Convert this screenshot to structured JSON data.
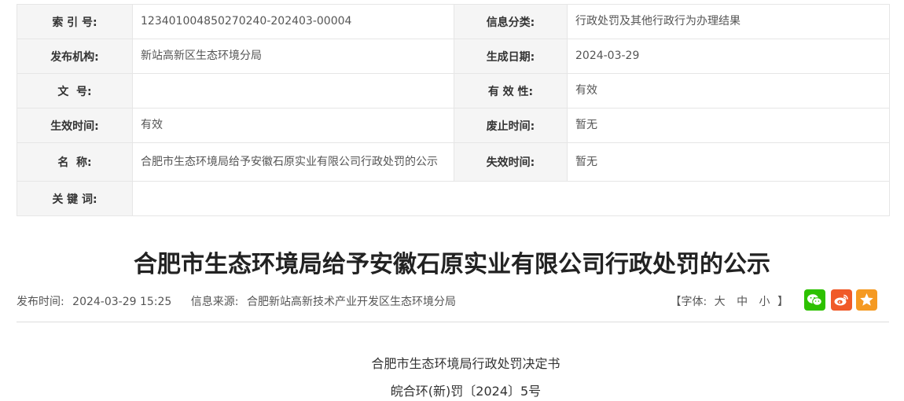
{
  "meta": {
    "rows": [
      {
        "l1": "索 引 号:",
        "v1": "123401004850270240-202403-00004",
        "l2": "信息分类:",
        "v2": "行政处罚及其他行政行为办理结果"
      },
      {
        "l1": "发布机构:",
        "v1": "新站高新区生态环境分局",
        "l2": "生成日期:",
        "v2": "2024-03-29"
      },
      {
        "l1": "文  号:",
        "v1": "",
        "l2": "有 效 性:",
        "v2": "有效"
      },
      {
        "l1": "生效时间:",
        "v1": "有效",
        "l2": "废止时间:",
        "v2": "暂无"
      },
      {
        "l1": "名  称:",
        "v1": "合肥市生态环境局给予安徽石原实业有限公司行政处罚的公示",
        "l2": "失效时间:",
        "v2": "暂无"
      },
      {
        "l1": "关 键 词:",
        "v1": ""
      }
    ]
  },
  "article": {
    "title": "合肥市生态环境局给予安徽石原实业有限公司行政处罚的公示",
    "publish_label": "发布时间:",
    "publish_time": "2024-03-29 15:25",
    "source_label": "信息来源:",
    "source": "合肥新站高新技术产业开发区生态环境分局",
    "font_prefix": "【字体:",
    "font_large": "大",
    "font_medium": "中",
    "font_small": "小",
    "font_suffix": "】",
    "doc_title": "合肥市生态环境局行政处罚决定书",
    "doc_number": "皖合环(新)罚〔2024〕5号"
  },
  "colors": {
    "wechat": "#2dc100",
    "weibo": "#f05a28",
    "favorite": "#f59a23"
  },
  "icons": {
    "wechat": "wechat-icon",
    "weibo": "weibo-icon",
    "favorite": "star-icon"
  }
}
